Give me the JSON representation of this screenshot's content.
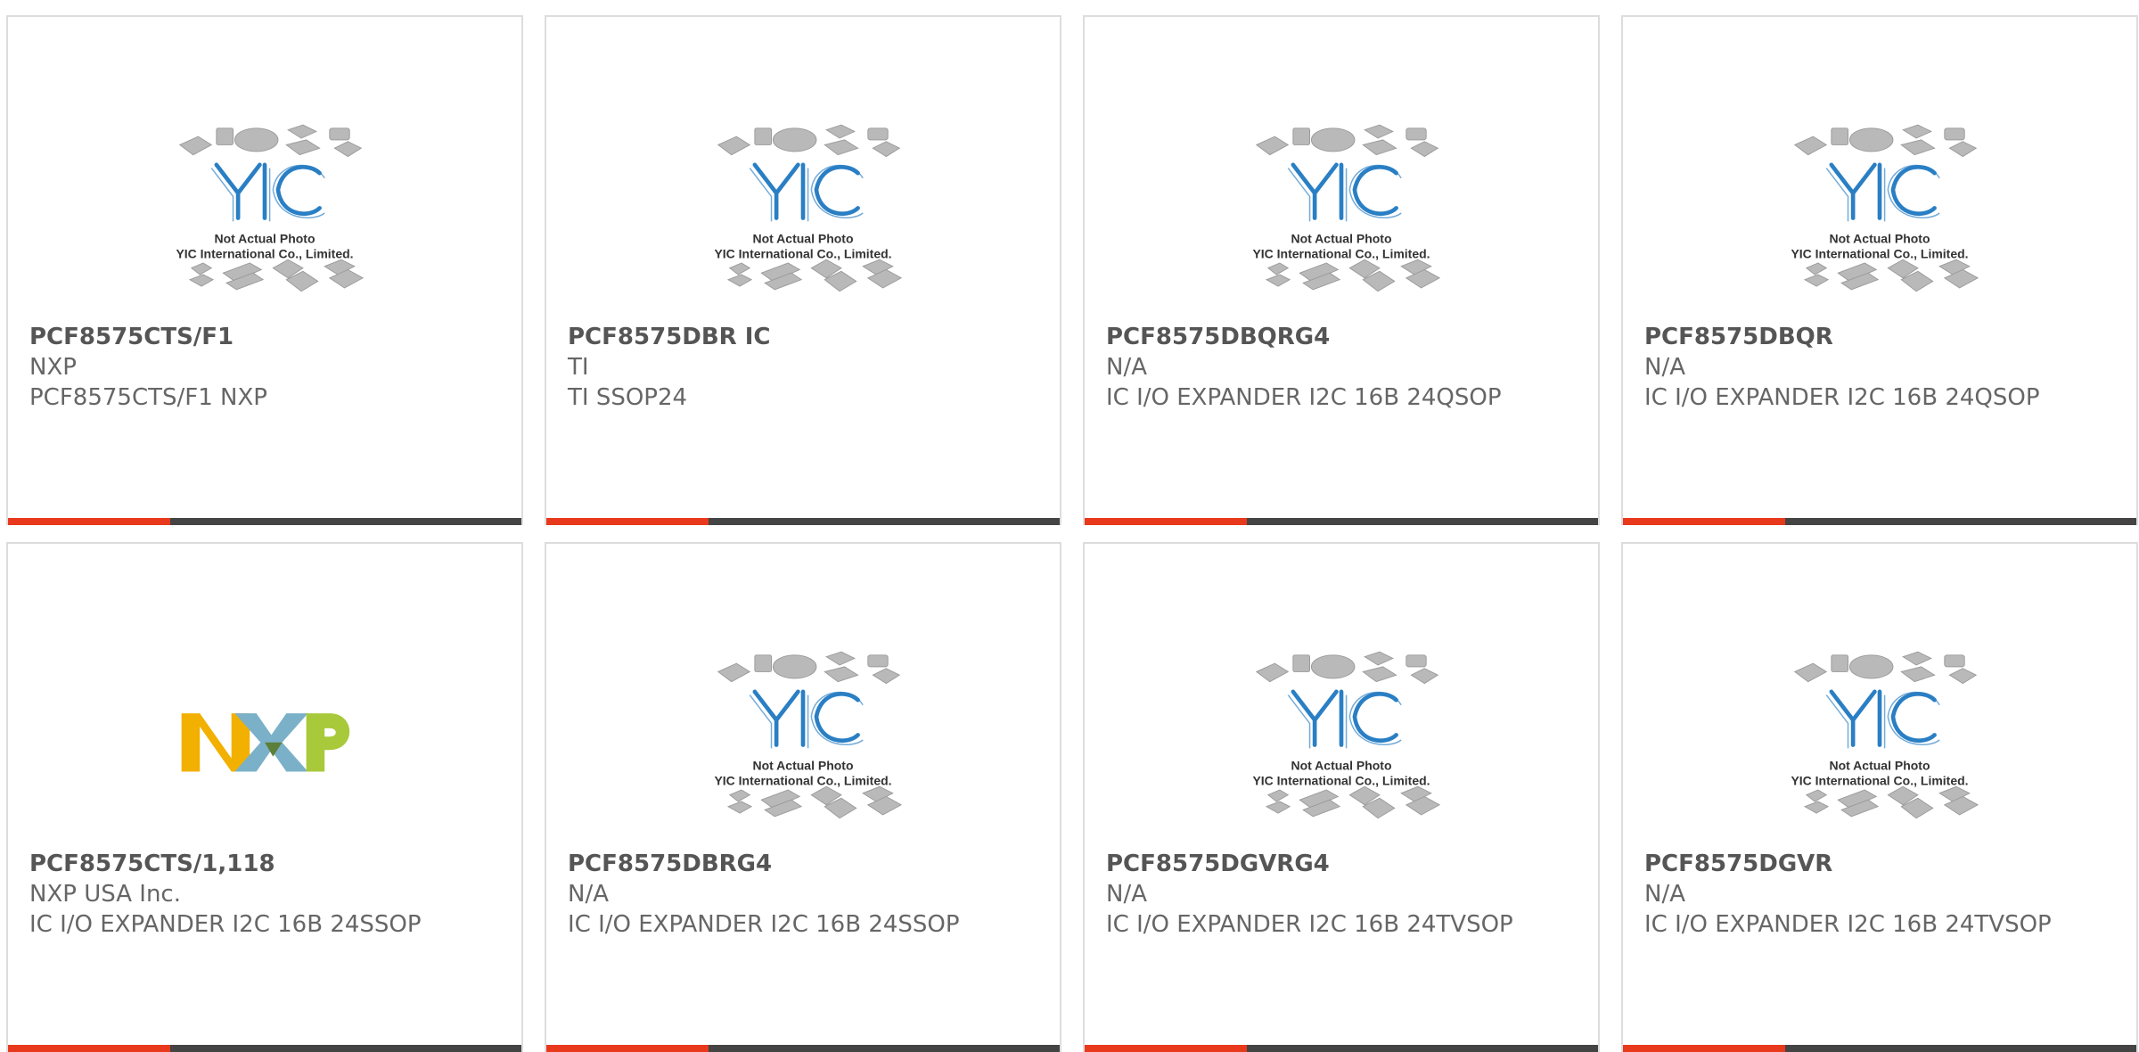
{
  "products": [
    {
      "part": "PCF8575CTS/F1",
      "brand": "NXP",
      "desc": "PCF8575CTS/F1 NXP",
      "image": "yic-placeholder"
    },
    {
      "part": "PCF8575DBR IC",
      "brand": "TI",
      "desc": "TI SSOP24",
      "image": "yic-placeholder"
    },
    {
      "part": "PCF8575DBQRG4",
      "brand": "N/A",
      "desc": "IC I/O EXPANDER I2C 16B 24QSOP",
      "image": "yic-placeholder"
    },
    {
      "part": "PCF8575DBQR",
      "brand": "N/A",
      "desc": "IC I/O EXPANDER I2C 16B 24QSOP",
      "image": "yic-placeholder"
    },
    {
      "part": "PCF8575CTS/1,118",
      "brand": "NXP USA Inc.",
      "desc": "IC I/O EXPANDER I2C 16B 24SSOP",
      "image": "nxp-logo"
    },
    {
      "part": "PCF8575DBRG4",
      "brand": "N/A",
      "desc": "IC I/O EXPANDER I2C 16B 24SSOP",
      "image": "yic-placeholder"
    },
    {
      "part": "PCF8575DGVRG4",
      "brand": "N/A",
      "desc": "IC I/O EXPANDER I2C 16B 24TVSOP",
      "image": "yic-placeholder"
    },
    {
      "part": "PCF8575DGVR",
      "brand": "N/A",
      "desc": "IC I/O EXPANDER I2C 16B 24TVSOP",
      "image": "yic-placeholder"
    }
  ],
  "placeholder": {
    "logo_text": "YIC",
    "line1": "Not Actual Photo",
    "line2": "YIC International Co., Limited."
  },
  "nxp_logo_text": "NXP",
  "colors": {
    "accent": "#e8391d",
    "bar": "#444444",
    "yic_blue": "#2a7fc4",
    "chip_gray": "#b9b9b9"
  }
}
